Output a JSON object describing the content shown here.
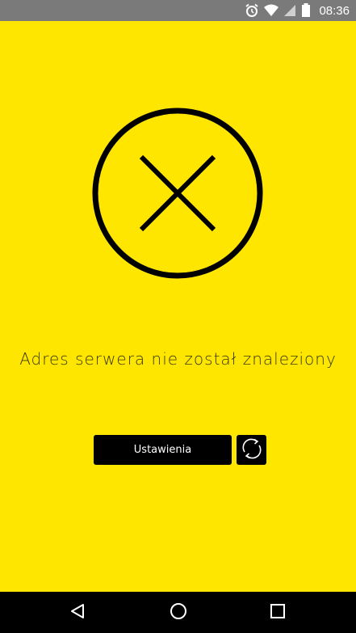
{
  "status_bar": {
    "time": "08:36",
    "icons": [
      "alarm-icon",
      "wifi-icon",
      "signal-icon",
      "battery-icon"
    ]
  },
  "error": {
    "icon": "close-circle-icon",
    "message": "Adres serwera nie został znaleziony"
  },
  "actions": {
    "settings_label": "Ustawienia",
    "refresh_icon": "refresh-icon"
  },
  "nav_bar": {
    "icons": [
      "back-icon",
      "home-icon",
      "recent-apps-icon"
    ]
  },
  "colors": {
    "background": "#ffe600",
    "button": "#000000",
    "button_text": "#ffffff",
    "status_bar": "#7a7a7a",
    "nav_bar": "#000000"
  }
}
